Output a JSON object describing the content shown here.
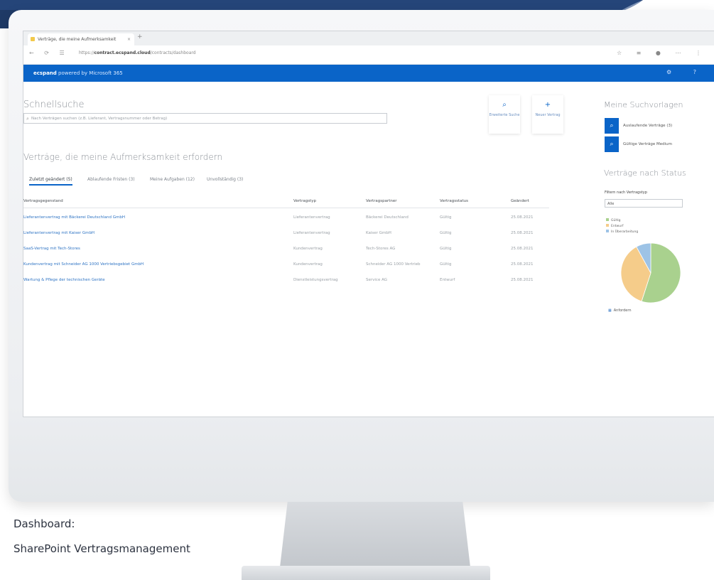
{
  "caption": {
    "line1": "Dashboard:",
    "line2": "SharePoint  Vertragsmanagement"
  },
  "browser": {
    "tab_title": "Verträge, die meine Aufmerksamkeit erfordern",
    "tab_close": "×",
    "new_tab": "+",
    "url_prefix": "https://",
    "url_domain": "contract.ecspand.cloud",
    "url_path": "/contracts/dashboard",
    "nav_icons": "← ⟳ ☰",
    "right_icons": "☆ ≡ ● ⋯ ⋮"
  },
  "suite": {
    "brand": "ecspand",
    "title": "powered by Microsoft 365",
    "icons": "⚙ ?"
  },
  "search": {
    "heading": "Schnellsuche",
    "placeholder": "Nach Verträgen suchen (z.B. Lieferant, Vertragsnummer oder Betrag)"
  },
  "tiles": [
    {
      "label": "Erweiterte Suche"
    },
    {
      "label": "Neuer Vertrag"
    }
  ],
  "contracts": {
    "heading": "Verträge, die meine Aufmerksamkeit erfordern",
    "tabs": [
      "Zuletzt geändert (5)",
      "Ablaufende Fristen (3)",
      "Meine Aufgaben (12)",
      "Unvollständig (3)"
    ],
    "columns": [
      "Vertragsgegenstand",
      "Vertragstyp",
      "Vertragspartner",
      "Vertragsstatus",
      "Geändert"
    ],
    "rows": [
      [
        "Lieferantenvertrag mit Bäckerei Deutschland GmbH",
        "Lieferantenvertrag",
        "Bäckerei Deutschland",
        "Gültig",
        "25.08.2021"
      ],
      [
        "Lieferantenvertrag mit Kaiser GmbH",
        "Lieferantenvertrag",
        "Kaiser GmbH",
        "Gültig",
        "25.08.2021"
      ],
      [
        "SaaS-Vertrag mit Tech-Stores",
        "Kundenvertrag",
        "Tech-Stores AG",
        "Gültig",
        "25.08.2021"
      ],
      [
        "Kundenvertrag mit Schneider AG 1000 Vertriebsgebiet GmbH",
        "Kundenvertrag",
        "Schneider AG 1000 Vertrieb",
        "Gültig",
        "25.08.2021"
      ],
      [
        "Wartung & Pflege der technischen Geräte",
        "Dienstleistungsvertrag",
        "Service AG",
        "Entwurf",
        "25.08.2021"
      ]
    ]
  },
  "sidebar": {
    "templates_heading": "Meine Suchvorlagen",
    "templates": [
      {
        "label": "Auslaufende Verträge (3)"
      },
      {
        "label": "Gültige Verträge Medium"
      }
    ],
    "status_heading": "Verträge nach Status",
    "filter_label": "Filtern nach Vertragstyp",
    "filter_value": "Alle",
    "export_label": "Anfordern"
  },
  "chart_data": {
    "type": "pie",
    "labels": [
      "Gültig",
      "Entwurf",
      "In Überarbeitung"
    ],
    "values": [
      55,
      37,
      8
    ],
    "colors": [
      "#a9d18e",
      "#f5cc8a",
      "#9dc3e6"
    ]
  }
}
